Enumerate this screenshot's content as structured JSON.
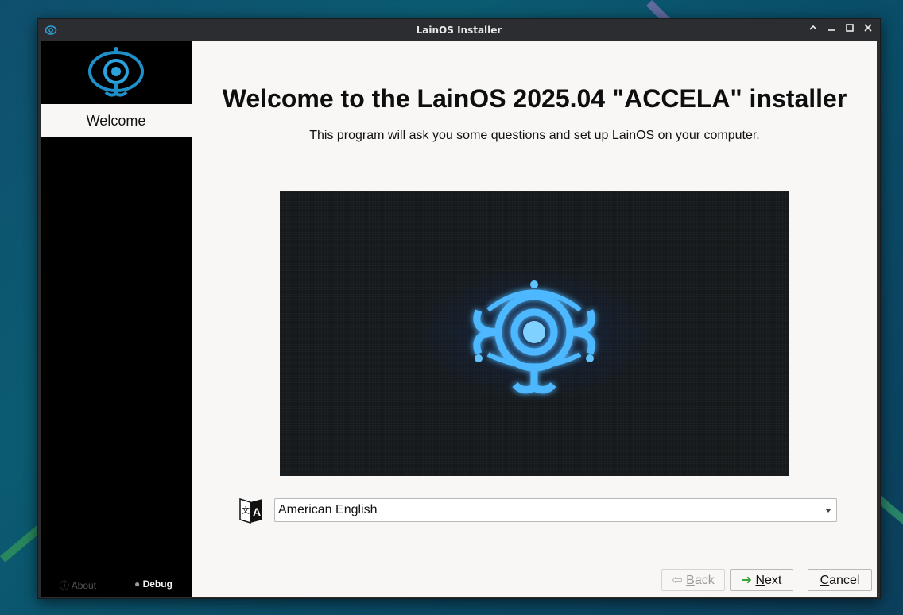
{
  "window": {
    "title": "LainOS Installer",
    "controls": [
      "chevron-up-icon",
      "minimize-icon",
      "maximize-icon",
      "close-icon"
    ]
  },
  "sidebar": {
    "steps": [
      {
        "label": "Welcome",
        "active": true
      }
    ],
    "about_label": "About",
    "debug_label": "Debug"
  },
  "main": {
    "heading": "Welcome to the LainOS 2025.04 \"ACCELA\" installer",
    "subtitle": "This program will ask you some questions and set up LainOS on your computer.",
    "language": {
      "selected": "American English"
    }
  },
  "buttons": {
    "back": {
      "mnemonic": "B",
      "rest": "ack",
      "enabled": false
    },
    "next": {
      "mnemonic": "N",
      "rest": "ext",
      "enabled": true
    },
    "cancel": {
      "mnemonic": "C",
      "rest": "ancel",
      "enabled": true
    }
  },
  "colors": {
    "accent": "#2a9fd6",
    "sidebar_bg": "#000000",
    "content_bg": "#f8f7f5"
  }
}
